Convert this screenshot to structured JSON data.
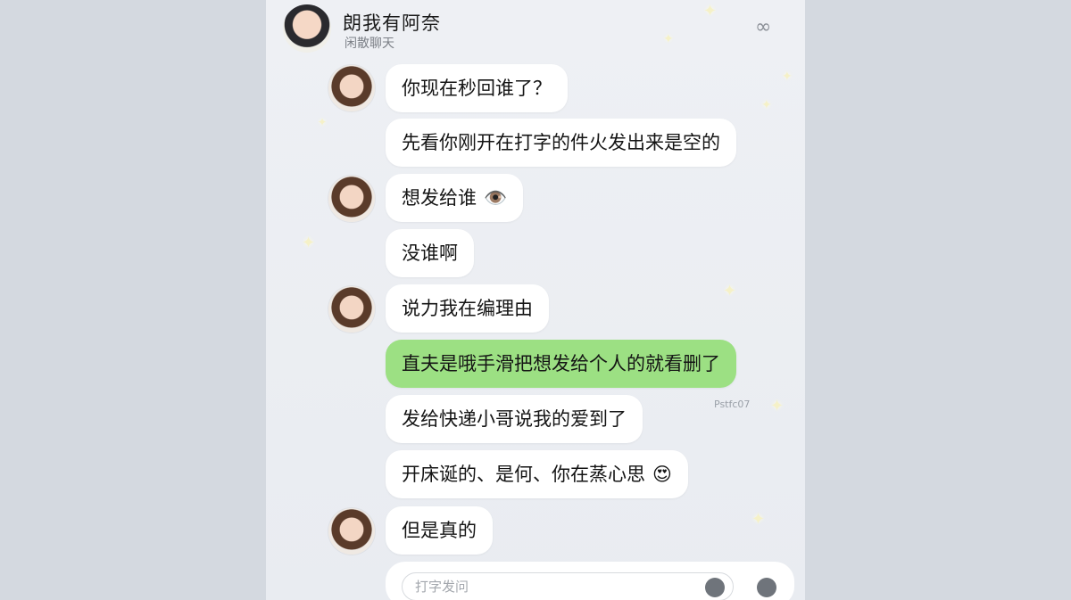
{
  "header": {
    "contact_name": "朗我有阿奈",
    "status": "闲散聊天",
    "more_icon": "more-icon"
  },
  "messages": [
    {
      "text": "你现在秒回谁了？",
      "type": "received",
      "avatar": true
    },
    {
      "text": "先看你刚开在打字的件火发出来是空的",
      "type": "received",
      "avatar": false
    },
    {
      "text": "想发给谁",
      "emoji": "👁️",
      "type": "received",
      "avatar": true
    },
    {
      "text": "没谁啊",
      "type": "received",
      "avatar": false
    },
    {
      "text": "说力我在编理由",
      "type": "received",
      "avatar": true
    },
    {
      "text": "直夫是哦手滑把想发给个人的就看删了",
      "type": "sent",
      "avatar": false
    },
    {
      "text": "发给快递小哥说我的爱到了",
      "type": "received",
      "avatar": false
    },
    {
      "text": "开床诞的、是何、你在蒸心思",
      "emoji": "😍",
      "type": "received",
      "avatar": false
    },
    {
      "text": "但是真的",
      "type": "received",
      "avatar": true
    }
  ],
  "timestamp": "Pstfc07",
  "composer": {
    "placeholder": "打字发问",
    "voice_icon": "voice-icon",
    "emoji_icon": "emoji-icon"
  },
  "colors": {
    "sent_bubble": "#9ce083",
    "received_bubble": "#ffffff",
    "background": "#eceef2"
  }
}
